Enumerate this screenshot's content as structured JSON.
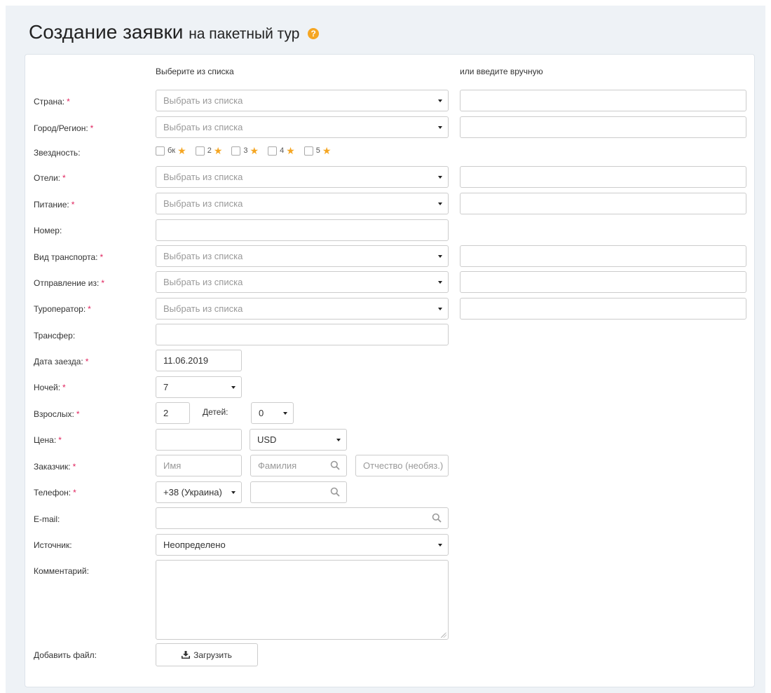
{
  "header": {
    "title_main": "Создание заявки",
    "title_sub": "на пакетный тур",
    "help_icon": "question-circle-icon",
    "help_glyph": "?"
  },
  "columns": {
    "select_header": "Выберите из списка",
    "manual_header": "или введите вручную"
  },
  "required_mark": "*",
  "select_placeholder": "Выбрать из списка",
  "fields": {
    "country": {
      "label": "Страна:"
    },
    "city": {
      "label": "Город/Регион:"
    },
    "stars": {
      "label": "Звездность:",
      "options": [
        {
          "value": "бк",
          "icon": "star-icon"
        },
        {
          "value": "2",
          "icon": "star-icon"
        },
        {
          "value": "3",
          "icon": "star-icon"
        },
        {
          "value": "4",
          "icon": "star-icon"
        },
        {
          "value": "5",
          "icon": "star-icon"
        }
      ],
      "star_color": "#f5a623"
    },
    "hotels": {
      "label": "Отели:"
    },
    "meal": {
      "label": "Питание:"
    },
    "room": {
      "label": "Номер:"
    },
    "transport": {
      "label": "Вид транспорта:"
    },
    "departure": {
      "label": "Отправление из:"
    },
    "operator": {
      "label": "Туроператор:"
    },
    "transfer": {
      "label": "Трансфер:"
    },
    "checkin_date": {
      "label": "Дата заезда:",
      "value": "11.06.2019"
    },
    "nights": {
      "label": "Ночей:",
      "value": "7"
    },
    "adults": {
      "label": "Взрослых:",
      "value": "2"
    },
    "children": {
      "label": "Детей:",
      "value": "0"
    },
    "price": {
      "label": "Цена:",
      "currency": "USD"
    },
    "customer": {
      "label": "Заказчик:",
      "first_name_placeholder": "Имя",
      "last_name_placeholder": "Фамилия",
      "middle_name_placeholder": "Отчество (необяз.)"
    },
    "phone": {
      "label": "Телефон:",
      "code": "+38 (Украина)"
    },
    "email": {
      "label": "E-mail:"
    },
    "source": {
      "label": "Источник:",
      "value": "Неопределено"
    },
    "comment": {
      "label": "Комментарий:"
    },
    "file": {
      "label": "Добавить файл:",
      "button": "Загрузить",
      "icon": "download-icon"
    }
  },
  "colors": {
    "background": "#eef2f6",
    "required": "#e0245e",
    "accent": "#f5a623"
  }
}
